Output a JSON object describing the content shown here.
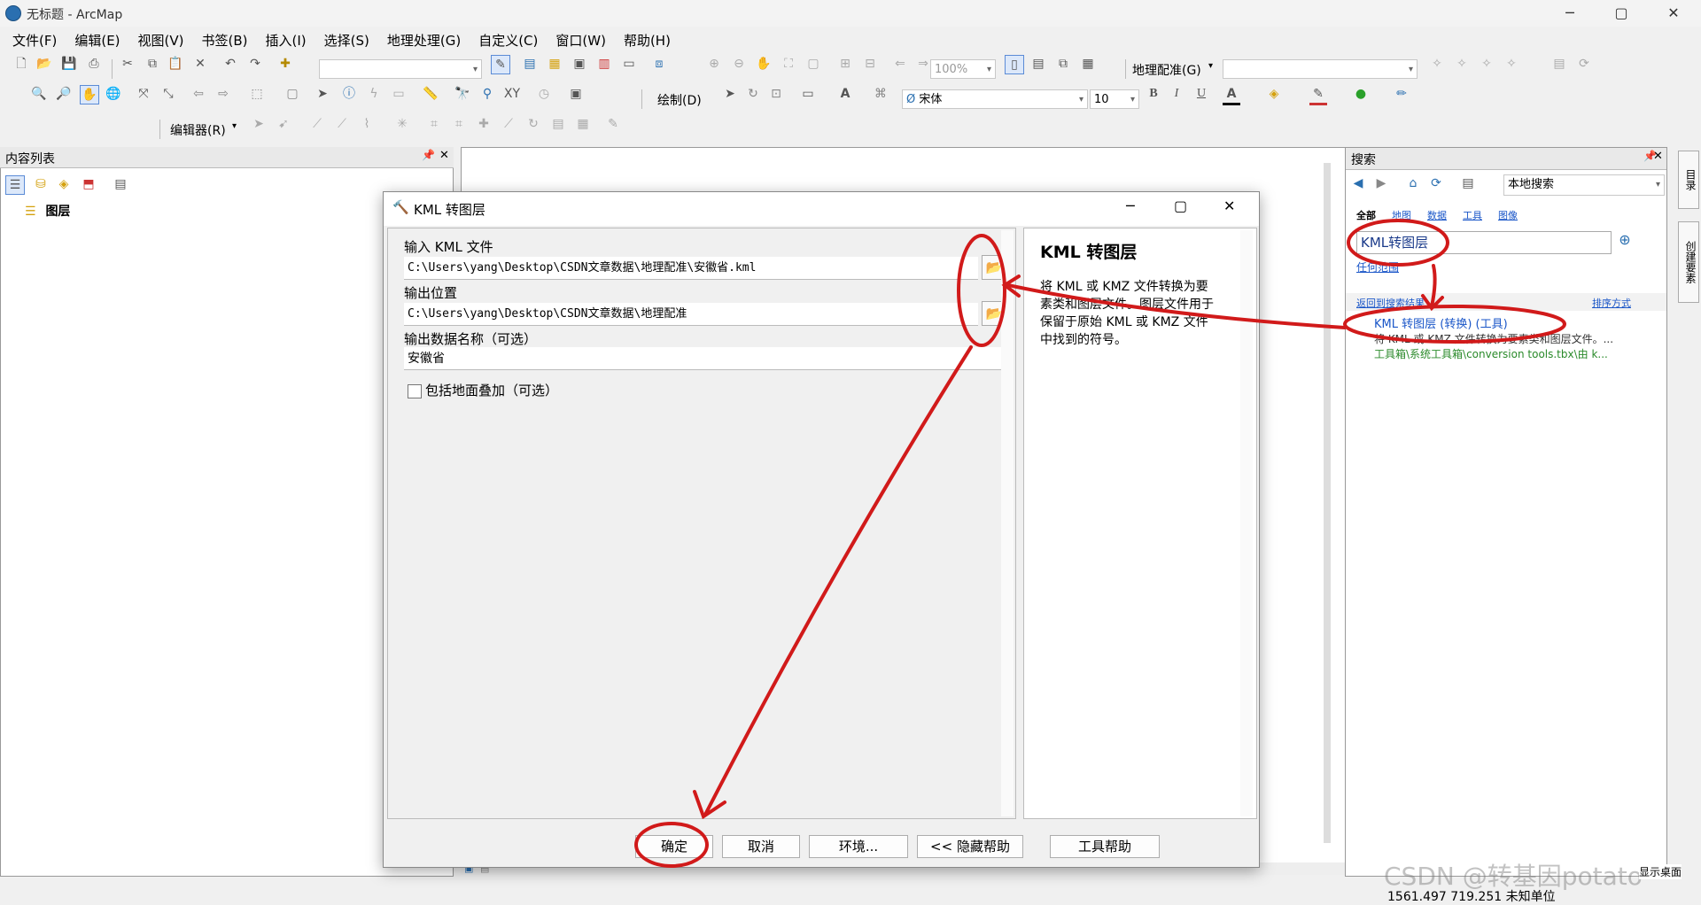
{
  "window": {
    "title": "无标题 - ArcMap",
    "min": "─",
    "max": "▢",
    "close": "✕"
  },
  "menu": [
    "文件(F)",
    "编辑(E)",
    "视图(V)",
    "书签(B)",
    "插入(I)",
    "选择(S)",
    "地理处理(G)",
    "自定义(C)",
    "窗口(W)",
    "帮助(H)"
  ],
  "toolbar": {
    "zoom_value": "100%",
    "georef_label": "地理配准(G)",
    "draw_label": "绘制(D)",
    "font_name": "宋体",
    "font_size": "10",
    "bold": "B",
    "italic": "I",
    "underline": "U",
    "editor_label": "编辑器(R)"
  },
  "toc": {
    "title": "内容列表",
    "pin": "ᚿ",
    "close": "✕",
    "layers_label": "图层"
  },
  "search_panel": {
    "title": "搜索",
    "scope": "本地搜索",
    "tabs": [
      "全部",
      "地图",
      "数据",
      "工具",
      "图像"
    ],
    "query": "KML转图层",
    "any_extent": "任何范围",
    "back_to_results": "返回到搜索结果",
    "sort": "排序方式",
    "result_title": "KML 转图层 (转换) (工具)",
    "result_desc": "将 KML 或 KMZ 文件转换为要素类和图层文件。...",
    "result_path": "工具箱\\系统工具箱\\conversion tools.tbx\\由 k..."
  },
  "side_tabs": [
    "目录",
    "创建要素"
  ],
  "dialog": {
    "title": "KML 转图层",
    "input_label": "输入 KML 文件",
    "input_value": "C:\\Users\\yang\\Desktop\\CSDN文章数据\\地理配准\\安徽省.kml",
    "output_label": "输出位置",
    "output_value": "C:\\Users\\yang\\Desktop\\CSDN文章数据\\地理配准",
    "name_label": "输出数据名称（可选）",
    "name_value": "安徽省",
    "checkbox_label": "包括地面叠加（可选）",
    "help_title": "KML 转图层",
    "help_text": "将 KML 或 KMZ 文件转换为要素类和图层文件。图层文件用于保留于原始 KML 或 KMZ 文件中找到的符号。",
    "buttons": {
      "ok": "确定",
      "cancel": "取消",
      "env": "环境...",
      "hide_help": "<< 隐藏帮助",
      "tool_help": "工具帮助"
    }
  },
  "status": {
    "coords": "1561.497  719.251 未知单位",
    "watermark": "CSDN @转基因potato",
    "show_desktop": "显示桌面"
  },
  "annotation_color": "#d11a1a"
}
